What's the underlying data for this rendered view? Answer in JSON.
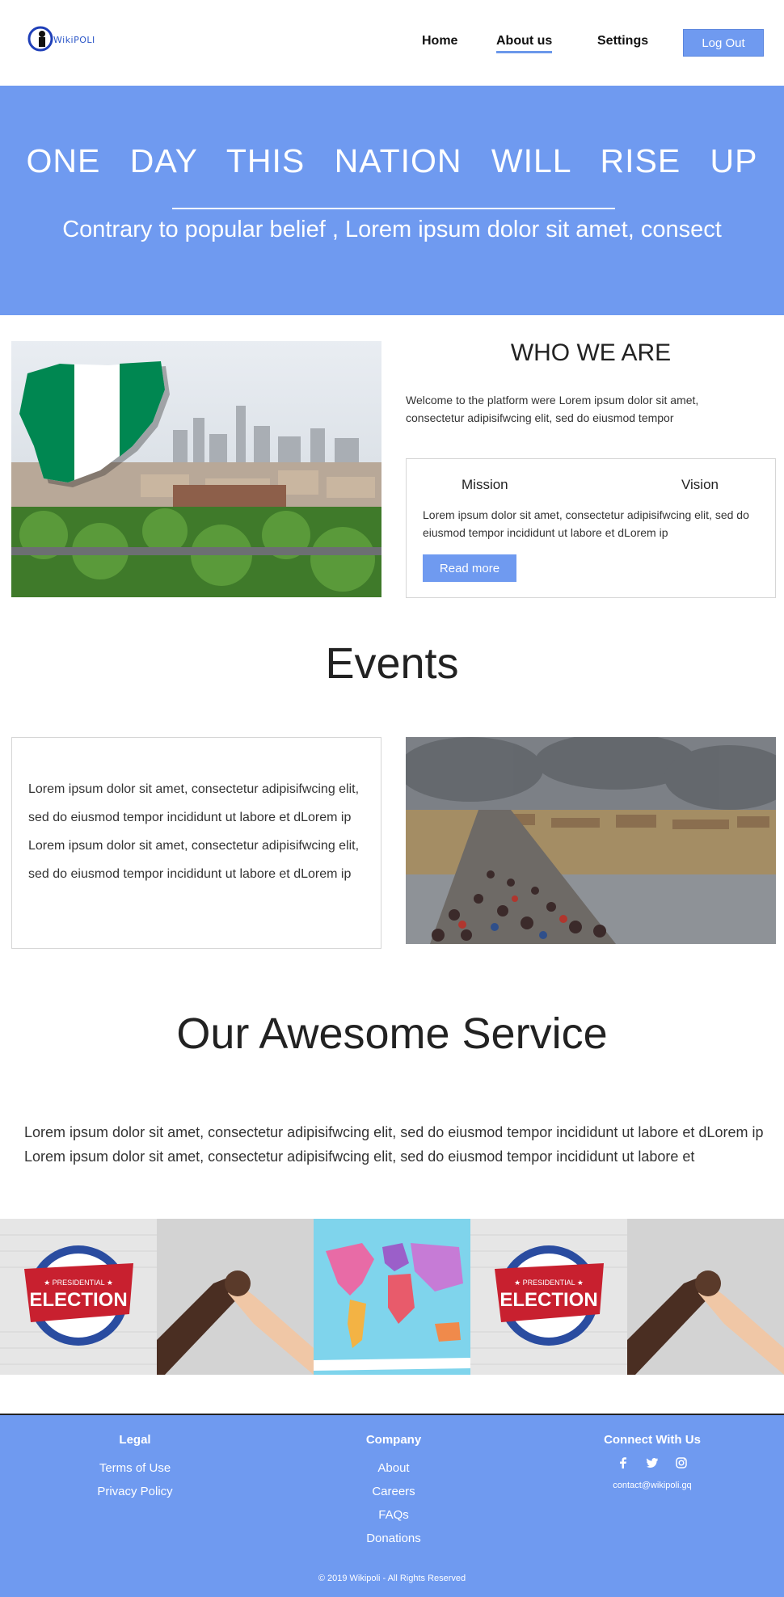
{
  "header": {
    "brand": "WikiPOLI",
    "nav": [
      {
        "label": "Home"
      },
      {
        "label": "About us"
      },
      {
        "label": "Settings"
      }
    ],
    "logout_label": "Log Out"
  },
  "hero": {
    "title": "ONE DAY THIS NATION WILL RISE UP",
    "subtitle": "Contrary to popular belief , Lorem ipsum dolor sit amet, consect"
  },
  "who": {
    "title": "WHO WE ARE",
    "text": "Welcome to the platform were Lorem ipsum dolor sit amet, consectetur adipisifwcing elit, sed do eiusmod tempor",
    "mission_label": "Mission",
    "vision_label": "Vision",
    "mv_text": "Lorem ipsum dolor sit amet, consectetur adipisifwcing elit, sed do eiusmod tempor incididunt ut labore et dLorem ip",
    "read_more_label": "Read more"
  },
  "events": {
    "title": "Events",
    "text": "Lorem ipsum dolor sit amet, consectetur adipisifwcing elit, sed do eiusmod tempor incididunt ut labore et dLorem ip Lorem ipsum dolor sit amet, consectetur adipisifwcing elit, sed do eiusmod tempor incididunt ut labore et dLorem ip"
  },
  "service": {
    "title": "Our Awesome Service",
    "text": "Lorem ipsum dolor sit amet, consectetur adipisifwcing elit, sed do eiusmod tempor incididunt ut labore et dLorem ip Lorem ipsum dolor sit amet, consectetur adipisifwcing elit, sed do eiusmod tempor incididunt ut labore et"
  },
  "gallery": {
    "election_banner_top": "★ PRESIDENTIAL ★",
    "election_banner_main": "ELECTION"
  },
  "footer": {
    "legal": {
      "title": "Legal",
      "links": [
        "Terms of Use",
        "Privacy Policy"
      ]
    },
    "company": {
      "title": "Company",
      "links": [
        "About",
        "Careers",
        "FAQs",
        "Donations"
      ]
    },
    "connect": {
      "title": "Connect With Us",
      "icons": [
        "facebook-icon",
        "twitter-icon",
        "instagram-icon"
      ],
      "email": "contact@wikipoli.gq"
    },
    "copyright": "© 2019 Wikipoli - All Rights Reserved"
  },
  "colors": {
    "accent": "#6f9af0",
    "text": "#222222"
  }
}
